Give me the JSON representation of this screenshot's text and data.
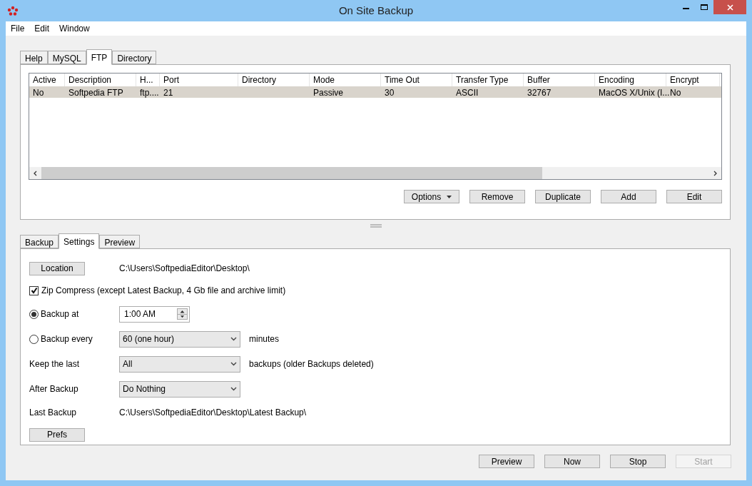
{
  "window": {
    "title": "On Site Backup"
  },
  "menu": [
    "File",
    "Edit",
    "Window"
  ],
  "top_tabs": [
    {
      "label": "Help",
      "selected": false
    },
    {
      "label": "MySQL",
      "selected": false
    },
    {
      "label": "FTP",
      "selected": true
    },
    {
      "label": "Directory",
      "selected": false
    }
  ],
  "table": {
    "columns": [
      "Active",
      "Description",
      "H...",
      "Port",
      "Directory",
      "Mode",
      "Time Out",
      "Transfer Type",
      "Buffer",
      "Encoding",
      "Encrypt"
    ],
    "rows": [
      {
        "selected": true,
        "cells": [
          "No",
          "Softpedia FTP",
          "ftp....",
          "21",
          "",
          "Passive",
          "30",
          "ASCII",
          "32767",
          "MacOS X/Unix (I...",
          "No"
        ]
      }
    ]
  },
  "table_buttons": [
    {
      "label": "Options",
      "kind": "menu"
    },
    {
      "label": "Remove",
      "kind": "plain"
    },
    {
      "label": "Duplicate",
      "kind": "plain"
    },
    {
      "label": "Add",
      "kind": "plain"
    },
    {
      "label": "Edit",
      "kind": "plain"
    }
  ],
  "bottom_tabs": [
    {
      "label": "Backup",
      "selected": false
    },
    {
      "label": "Settings",
      "selected": true
    },
    {
      "label": "Preview",
      "selected": false
    }
  ],
  "settings": {
    "location_button": "Location",
    "location_path": "C:\\Users\\SoftpediaEditor\\Desktop\\",
    "zip": {
      "label": "Zip Compress (except Latest Backup, 4 Gb file and archive limit)",
      "checked": true
    },
    "backup_at": {
      "label": "Backup at",
      "selected": true,
      "value": "1:00 AM"
    },
    "backup_every": {
      "label": "Backup every",
      "selected": false,
      "value": "60 (one hour)",
      "unit": "minutes"
    },
    "keep_last": {
      "label": "Keep the last",
      "value": "All",
      "suffix": "backups (older Backups deleted)"
    },
    "after_backup": {
      "label": "After Backup",
      "value": "Do Nothing"
    },
    "last_backup": {
      "label": "Last Backup",
      "value": "C:\\Users\\SoftpediaEditor\\Desktop\\Latest Backup\\"
    },
    "prefs_button": "Prefs"
  },
  "footer_buttons": [
    {
      "label": "Preview",
      "disabled": false
    },
    {
      "label": "Now",
      "disabled": false
    },
    {
      "label": "Stop",
      "disabled": false
    },
    {
      "label": "Start",
      "disabled": true
    }
  ]
}
